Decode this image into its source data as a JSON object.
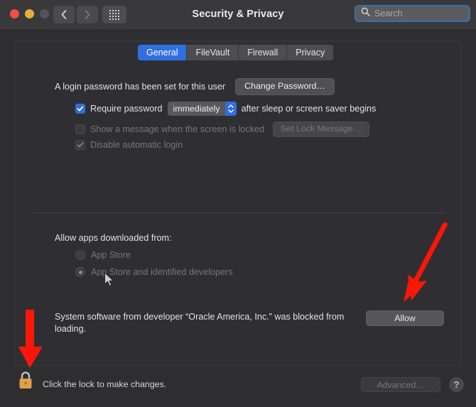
{
  "window": {
    "title": "Security & Privacy",
    "traffic_lights": [
      "close",
      "minimize",
      "zoom"
    ],
    "nav": {
      "back": "back-chevron",
      "forward": "forward-chevron",
      "show_all": "grid-icon"
    },
    "search": {
      "placeholder": "Search",
      "value": "",
      "icon": "search-icon"
    }
  },
  "tabs": [
    {
      "label": "General",
      "active": true
    },
    {
      "label": "FileVault",
      "active": false
    },
    {
      "label": "Firewall",
      "active": false
    },
    {
      "label": "Privacy",
      "active": false
    }
  ],
  "general": {
    "login_password_text": "A login password has been set for this user",
    "change_password_label": "Change Password…",
    "require_password": {
      "checked": true,
      "enabled": true,
      "label_before": "Require password",
      "delay_value": "immediately",
      "label_after": "after sleep or screen saver begins"
    },
    "show_message": {
      "checked": false,
      "enabled": false,
      "label": "Show a message when the screen is locked",
      "button_label": "Set Lock Message…"
    },
    "disable_auto_login": {
      "checked": true,
      "enabled": false,
      "label": "Disable automatic login"
    }
  },
  "allow_apps": {
    "heading": "Allow apps downloaded from:",
    "options": [
      {
        "label": "App Store",
        "selected": false,
        "enabled": false
      },
      {
        "label": "App Store and identified developers",
        "selected": true,
        "enabled": false
      }
    ]
  },
  "blocked": {
    "message": "System software from developer “Oracle America, Inc.” was blocked from loading.",
    "allow_label": "Allow"
  },
  "footer": {
    "lock_icon": "lock-closed-icon",
    "lock_state": "locked",
    "caption": "Click the lock to make changes.",
    "advanced_label": "Advanced…",
    "advanced_enabled": false,
    "help_label": "?"
  },
  "annotations": [
    {
      "name": "arrow-pointing-to-allow-button",
      "color": "#fa1608",
      "direction": "down-left"
    },
    {
      "name": "arrow-pointing-to-lock",
      "color": "#fa1608",
      "direction": "down"
    }
  ],
  "colors": {
    "accent_blue": "#2f6fe0",
    "annotation_red": "#fa1608",
    "lock_gold": "#dfa047",
    "window_bg": "#2e2e31",
    "titlebar_bg": "#39393c"
  }
}
